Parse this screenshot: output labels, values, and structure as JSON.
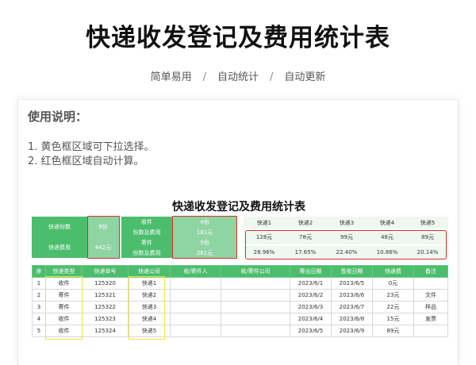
{
  "page": {
    "title": "快递收发登记及费用统计表",
    "tags": [
      "简单易用",
      "自动统计",
      "自动更新"
    ],
    "separator": "/"
  },
  "instructions": {
    "heading": "使用说明：",
    "lines": [
      "1. 黄色框区域可下拉选择。",
      "2. 红色框区域自动计算。"
    ]
  },
  "sheet": {
    "title": "快递收发登记及费用统计表",
    "summary": {
      "count_label": "快递份数",
      "count_value": "9份",
      "fee_label": "快递费用",
      "fee_value": "442元",
      "receive_label": "收件",
      "receive_value": "4份",
      "receive_fee_label": "份数及费用",
      "receive_fee_value": "181元",
      "send_label": "寄件",
      "send_value": "5份",
      "send_fee_label": "份数及费用",
      "send_fee_value": "261元"
    },
    "couriers": {
      "names": [
        "快递1",
        "快递2",
        "快递3",
        "快递4",
        "快递5"
      ],
      "fees": [
        "128元",
        "78元",
        "99元",
        "48元",
        "89元"
      ],
      "shares": [
        "28.96%",
        "17.65%",
        "22.40%",
        "10.86%",
        "20.14%"
      ]
    },
    "headers": [
      "序",
      "快递类型",
      "快递单号",
      "快递公司",
      "收/寄件人",
      "收/寄件公司",
      "寄出日期",
      "签收日期",
      "快递费",
      "备注"
    ],
    "rows": [
      [
        "1",
        "收件",
        "125320",
        "快递1",
        "",
        "",
        "2023/6/1",
        "2023/6/5",
        "0元",
        ""
      ],
      [
        "2",
        "寄件",
        "125321",
        "快递2",
        "",
        "",
        "2023/6/2",
        "2023/6/6",
        "23元",
        "文件"
      ],
      [
        "3",
        "寄件",
        "125322",
        "快递3",
        "",
        "",
        "2023/6/3",
        "2023/6/7",
        "22元",
        "样品"
      ],
      [
        "4",
        "收件",
        "125323",
        "快递4",
        "",
        "",
        "2023/6/4",
        "2023/6/8",
        "15元",
        "发票"
      ],
      [
        "5",
        "收件",
        "125324",
        "快递5",
        "",
        "",
        "2023/6/5",
        "2023/6/9",
        "89元",
        ""
      ]
    ]
  }
}
